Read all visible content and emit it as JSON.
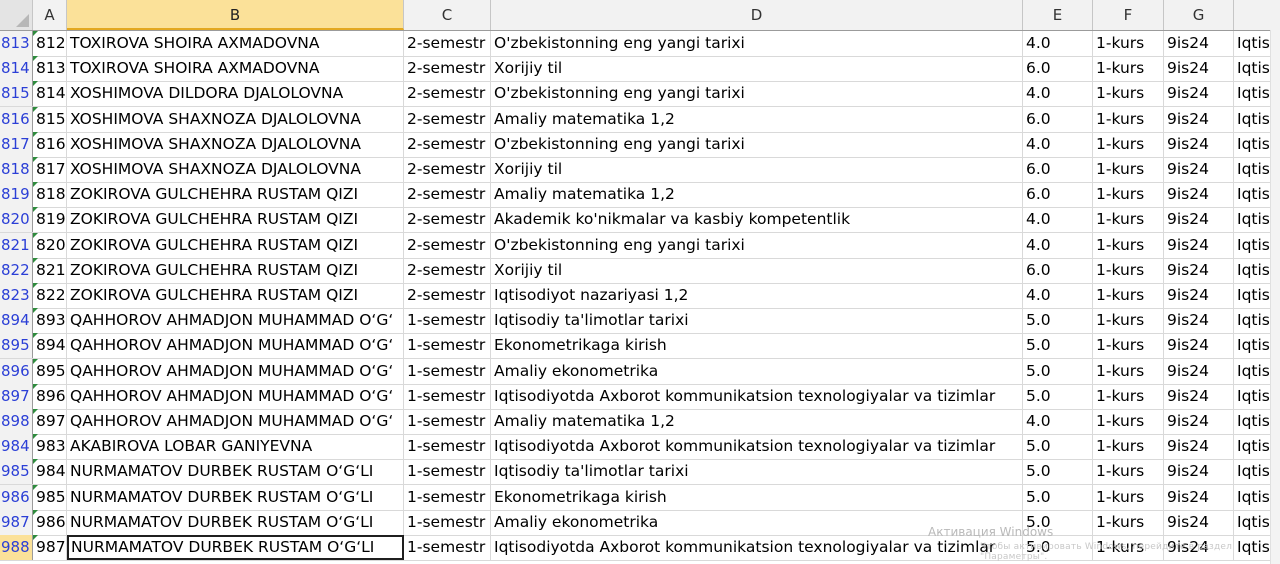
{
  "columns": {
    "a": "A",
    "b": "B",
    "c": "C",
    "d": "D",
    "e": "E",
    "f": "F",
    "g": "G"
  },
  "rows": [
    {
      "n": "813",
      "id": "812",
      "name": "TOXIROVA SHOIRA AXMADOVNA",
      "sem": "2-semestr",
      "subj": "O'zbekistonning eng yangi tarixi",
      "cred": "4.0",
      "kurs": "1-kurs",
      "grp": "9is24",
      "h": "Iqtis"
    },
    {
      "n": "814",
      "id": "813",
      "name": "TOXIROVA SHOIRA AXMADOVNA",
      "sem": "2-semestr",
      "subj": "Xorijiy til",
      "cred": "6.0",
      "kurs": "1-kurs",
      "grp": "9is24",
      "h": "Iqtis"
    },
    {
      "n": "815",
      "id": "814",
      "name": "XOSHIMOVA DILDORA DJALOLOVNA",
      "sem": "2-semestr",
      "subj": "O'zbekistonning eng yangi tarixi",
      "cred": "4.0",
      "kurs": "1-kurs",
      "grp": "9is24",
      "h": "Iqtis"
    },
    {
      "n": "816",
      "id": "815",
      "name": "XOSHIMOVA SHAXNOZA DJALOLOVNA",
      "sem": "2-semestr",
      "subj": "Amaliy matematika 1,2",
      "cred": "6.0",
      "kurs": "1-kurs",
      "grp": "9is24",
      "h": "Iqtis"
    },
    {
      "n": "817",
      "id": "816",
      "name": "XOSHIMOVA SHAXNOZA DJALOLOVNA",
      "sem": "2-semestr",
      "subj": "O'zbekistonning eng yangi tarixi",
      "cred": "4.0",
      "kurs": "1-kurs",
      "grp": "9is24",
      "h": "Iqtis"
    },
    {
      "n": "818",
      "id": "817",
      "name": "XOSHIMOVA SHAXNOZA DJALOLOVNA",
      "sem": "2-semestr",
      "subj": "Xorijiy til",
      "cred": "6.0",
      "kurs": "1-kurs",
      "grp": "9is24",
      "h": "Iqtis"
    },
    {
      "n": "819",
      "id": "818",
      "name": "ZOKIROVA GULCHEHRA RUSTAM QIZI",
      "sem": "2-semestr",
      "subj": "Amaliy matematika 1,2",
      "cred": "6.0",
      "kurs": "1-kurs",
      "grp": "9is24",
      "h": "Iqtis"
    },
    {
      "n": "820",
      "id": "819",
      "name": "ZOKIROVA GULCHEHRA RUSTAM QIZI",
      "sem": "2-semestr",
      "subj": "Akademik ko'nikmalar va kasbiy kompetentlik",
      "cred": "4.0",
      "kurs": "1-kurs",
      "grp": "9is24",
      "h": "Iqtis"
    },
    {
      "n": "821",
      "id": "820",
      "name": "ZOKIROVA GULCHEHRA RUSTAM QIZI",
      "sem": "2-semestr",
      "subj": "O'zbekistonning eng yangi tarixi",
      "cred": "4.0",
      "kurs": "1-kurs",
      "grp": "9is24",
      "h": "Iqtis"
    },
    {
      "n": "822",
      "id": "821",
      "name": "ZOKIROVA GULCHEHRA RUSTAM QIZI",
      "sem": "2-semestr",
      "subj": "Xorijiy til",
      "cred": "6.0",
      "kurs": "1-kurs",
      "grp": "9is24",
      "h": "Iqtis"
    },
    {
      "n": "823",
      "id": "822",
      "name": "ZOKIROVA GULCHEHRA RUSTAM QIZI",
      "sem": "2-semestr",
      "subj": "Iqtisodiyot nazariyasi 1,2",
      "cred": "4.0",
      "kurs": "1-kurs",
      "grp": "9is24",
      "h": "Iqtis"
    },
    {
      "n": "894",
      "id": "893",
      "name": "QAHHOROV AHMADJON MUHAMMAD O‘G‘",
      "sem": "1-semestr",
      "subj": "Iqtisodiy ta'limotlar tarixi",
      "cred": "5.0",
      "kurs": "1-kurs",
      "grp": "9is24",
      "h": "Iqtis"
    },
    {
      "n": "895",
      "id": "894",
      "name": "QAHHOROV AHMADJON MUHAMMAD O‘G‘",
      "sem": "1-semestr",
      "subj": "Ekonometrikaga kirish",
      "cred": "5.0",
      "kurs": "1-kurs",
      "grp": "9is24",
      "h": "Iqtis"
    },
    {
      "n": "896",
      "id": "895",
      "name": "QAHHOROV AHMADJON MUHAMMAD O‘G‘",
      "sem": "1-semestr",
      "subj": "Amaliy ekonometrika",
      "cred": "5.0",
      "kurs": "1-kurs",
      "grp": "9is24",
      "h": "Iqtis"
    },
    {
      "n": "897",
      "id": "896",
      "name": "QAHHOROV AHMADJON MUHAMMAD O‘G‘",
      "sem": "1-semestr",
      "subj": "Iqtisodiyotda Axborot kommunikatsion texnologiyalar va tizimlar",
      "cred": "5.0",
      "kurs": "1-kurs",
      "grp": "9is24",
      "h": "Iqtis"
    },
    {
      "n": "898",
      "id": "897",
      "name": "QAHHOROV AHMADJON MUHAMMAD O‘G‘",
      "sem": "1-semestr",
      "subj": "Amaliy matematika 1,2",
      "cred": "4.0",
      "kurs": "1-kurs",
      "grp": "9is24",
      "h": "Iqtis"
    },
    {
      "n": "984",
      "id": "983",
      "name": "AKABIROVA LOBAR GANIYEVNA",
      "sem": "1-semestr",
      "subj": "Iqtisodiyotda Axborot kommunikatsion texnologiyalar va tizimlar",
      "cred": "5.0",
      "kurs": "1-kurs",
      "grp": "9is24",
      "h": "Iqtis"
    },
    {
      "n": "985",
      "id": "984",
      "name": "NURMAMATOV DURBEK RUSTAM O‘G‘LI",
      "sem": "1-semestr",
      "subj": "Iqtisodiy ta'limotlar tarixi",
      "cred": "5.0",
      "kurs": "1-kurs",
      "grp": "9is24",
      "h": "Iqtis"
    },
    {
      "n": "986",
      "id": "985",
      "name": "NURMAMATOV DURBEK RUSTAM O‘G‘LI",
      "sem": "1-semestr",
      "subj": "Ekonometrikaga kirish",
      "cred": "5.0",
      "kurs": "1-kurs",
      "grp": "9is24",
      "h": "Iqtis"
    },
    {
      "n": "987",
      "id": "986",
      "name": "NURMAMATOV DURBEK RUSTAM O‘G‘LI",
      "sem": "1-semestr",
      "subj": "Amaliy ekonometrika",
      "cred": "5.0",
      "kurs": "1-kurs",
      "grp": "9is24",
      "h": "Iqtis"
    },
    {
      "n": "988",
      "id": "987",
      "name": "NURMAMATOV DURBEK RUSTAM O‘G‘LI",
      "sem": "1-semestr",
      "subj": "Iqtisodiyotda Axborot kommunikatsion texnologiyalar va tizimlar",
      "cred": "5.0",
      "kurs": "1-kurs",
      "grp": "9is24",
      "h": "Iqtis"
    }
  ],
  "watermark": {
    "title": "Активация Windows",
    "subtitle": "Чтобы активировать Windows, перейдите в раздел \"Параметры\"."
  }
}
